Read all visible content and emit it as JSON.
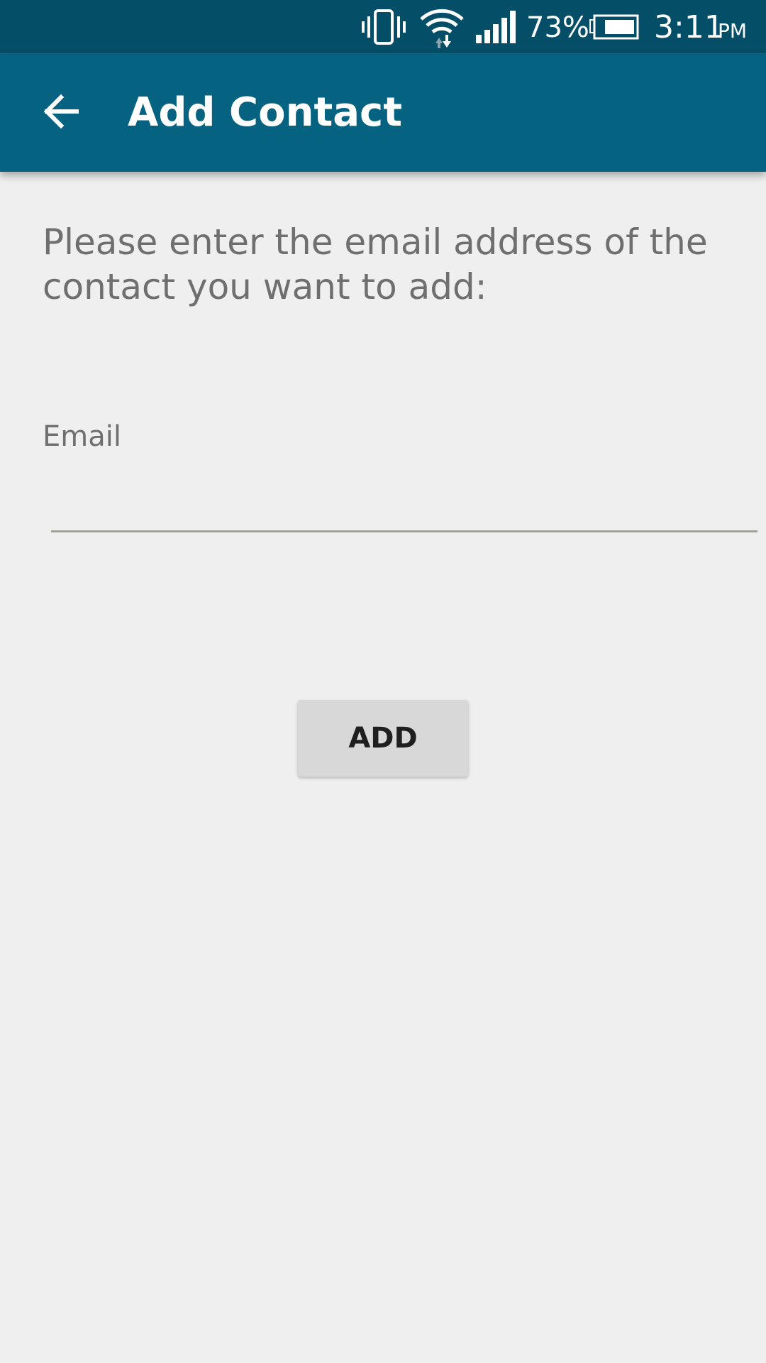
{
  "status_bar": {
    "battery_percent": "73%",
    "time": "3:11",
    "ampm": "PM",
    "icons": [
      "vibrate-icon",
      "wifi-icon",
      "signal-icon",
      "battery-icon"
    ],
    "background": "#044e68"
  },
  "app_bar": {
    "title": "Add Contact",
    "back_icon": "back-arrow-icon",
    "background": "#056381"
  },
  "content": {
    "instructions": "Please enter the email address of the contact you want to add:",
    "email_label": "Email",
    "email_value": "",
    "add_button_label": "ADD"
  },
  "colors": {
    "screen_background": "#efefef",
    "text_secondary": "#6f6f6f",
    "button_background": "#d8d8d8"
  }
}
